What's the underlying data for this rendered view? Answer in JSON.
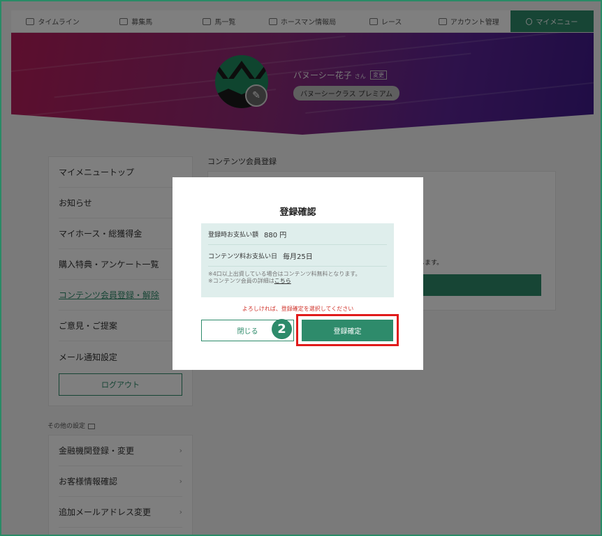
{
  "nav": {
    "items": [
      {
        "label": "タイムライン",
        "icon": "timeline-icon"
      },
      {
        "label": "募集馬",
        "icon": "horse-list-icon"
      },
      {
        "label": "馬一覧",
        "icon": "horseshoe-icon"
      },
      {
        "label": "ホースマン情報局",
        "icon": "info-icon"
      },
      {
        "label": "レース",
        "icon": "race-flag-icon"
      },
      {
        "label": "アカウント管理",
        "icon": "account-card-icon"
      },
      {
        "label": "マイメニュー",
        "icon": "user-icon"
      }
    ],
    "active_index": 6
  },
  "profile": {
    "name": "バヌーシー花子",
    "honorific": "さん",
    "change_label": "変更",
    "class_label": "バヌーシークラス プレミアム"
  },
  "sidebar": {
    "items": [
      "マイメニュートップ",
      "お知らせ",
      "マイホース・総獲得金",
      "購入特典・アンケート一覧",
      "コンテンツ会員登録・解除",
      "ご意見・ご提案",
      "メール通知設定"
    ],
    "logout_label": "ログアウト",
    "other_settings_label": "その他の設定",
    "other_items": [
      "金融機関登録・変更",
      "お客様情報確認",
      "追加メールアドレス変更"
    ]
  },
  "content": {
    "title": "コンテンツ会員登録",
    "partial_text": "します。"
  },
  "modal": {
    "title": "登録確認",
    "payment_label": "登録時お支払い額",
    "payment_value": "880 円",
    "fee_label": "コンテンツ料お支払い日",
    "fee_value": "毎月25日",
    "note_line1": "※4口以上出資している場合はコンテンツ料無料となります。",
    "note_line2": "※コンテンツ会員の詳細は",
    "note_link": "こちら",
    "confirm_message": "よろしければ、登録確定を選択してください",
    "close_label": "閉じる",
    "confirm_label": "登録確定"
  },
  "annotation": {
    "step_number": "2",
    "highlight_color": "#e01b1b"
  },
  "colors": {
    "accent": "#2e8b6b"
  }
}
